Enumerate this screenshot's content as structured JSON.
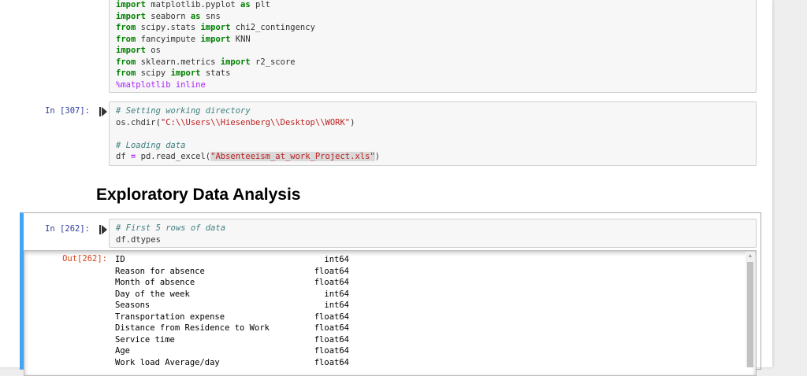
{
  "cell1": {
    "lines": [
      [
        {
          "t": "import",
          "c": "kw"
        },
        {
          "t": " matplotlib.pyplot "
        },
        {
          "t": "as",
          "c": "kw"
        },
        {
          "t": " plt"
        }
      ],
      [
        {
          "t": "import",
          "c": "kw"
        },
        {
          "t": " seaborn "
        },
        {
          "t": "as",
          "c": "kw"
        },
        {
          "t": " sns"
        }
      ],
      [
        {
          "t": "from",
          "c": "kw"
        },
        {
          "t": " scipy.stats "
        },
        {
          "t": "import",
          "c": "kw"
        },
        {
          "t": " chi2_contingency"
        }
      ],
      [
        {
          "t": "from",
          "c": "kw"
        },
        {
          "t": " fancyimpute "
        },
        {
          "t": "import",
          "c": "kw"
        },
        {
          "t": " KNN"
        }
      ],
      [
        {
          "t": "import",
          "c": "kw"
        },
        {
          "t": " os"
        }
      ],
      [
        {
          "t": "from",
          "c": "kw"
        },
        {
          "t": " sklearn.metrics "
        },
        {
          "t": "import",
          "c": "kw"
        },
        {
          "t": " r2_score"
        }
      ],
      [
        {
          "t": "from",
          "c": "kw"
        },
        {
          "t": " scipy "
        },
        {
          "t": "import",
          "c": "kw"
        },
        {
          "t": " stats"
        }
      ],
      [
        {
          "t": "%matplotlib inline",
          "c": "magic"
        }
      ]
    ]
  },
  "cell2": {
    "prompt": "In [307]:",
    "lines": [
      [
        {
          "t": "# Setting working directory",
          "c": "cmt"
        }
      ],
      [
        {
          "t": "os.chdir("
        },
        {
          "t": "\"C:\\\\Users\\\\Hiesenberg\\\\Desktop\\\\WORK\"",
          "c": "str"
        },
        {
          "t": ")"
        }
      ],
      [
        {
          "t": ""
        }
      ],
      [
        {
          "t": "# Loading data",
          "c": "cmt"
        }
      ],
      [
        {
          "t": "df "
        },
        {
          "t": "=",
          "c": "op"
        },
        {
          "t": " pd.read_excel("
        },
        {
          "t": "\"Absenteeism_at_work_Project.xls\"",
          "c": "str hl"
        },
        {
          "t": ")"
        }
      ]
    ]
  },
  "heading": "Exploratory Data Analysis",
  "cell3": {
    "prompt": "In [262]:",
    "lines": [
      [
        {
          "t": "# First 5 rows of data",
          "c": "cmt"
        }
      ],
      [
        {
          "t": "df.dtypes"
        }
      ]
    ],
    "out_prompt": "Out[262]:",
    "dtypes": [
      {
        "name": "ID",
        "type": "int64"
      },
      {
        "name": "Reason for absence",
        "type": "float64"
      },
      {
        "name": "Month of absence",
        "type": "float64"
      },
      {
        "name": "Day of the week",
        "type": "int64"
      },
      {
        "name": "Seasons",
        "type": "int64"
      },
      {
        "name": "Transportation expense",
        "type": "float64"
      },
      {
        "name": "Distance from Residence to Work",
        "type": "float64"
      },
      {
        "name": "Service time",
        "type": "float64"
      },
      {
        "name": "Age",
        "type": "float64"
      },
      {
        "name": "Work load Average/day",
        "type": "float64"
      }
    ]
  },
  "colors": {
    "accent": "#42a5f5",
    "in_prompt": "#303f9f",
    "out_prompt": "#d84315"
  },
  "icons": {
    "run": "run-cell-icon"
  }
}
